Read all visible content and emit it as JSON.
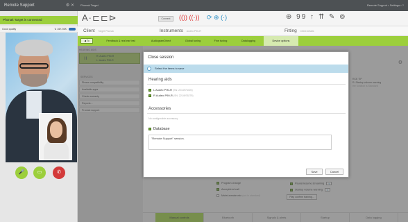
{
  "remote_support": {
    "title": "Remote Support",
    "window_controls": "⚙ ✕",
    "status": "Phonak Target is connected",
    "quality_label": "Good quality",
    "network_label": "⇅ 16K  56K",
    "buttons": {
      "mic": "🎤",
      "camera": "▭",
      "hangup": "✆"
    }
  },
  "topbar": {
    "title": "Phonak Target",
    "right": "Remote Support  •  Settings  •  ?"
  },
  "toolbar": {
    "connect_label": "Connect",
    "icons_left": "A·⊏⊏⊳",
    "icons_red": "(()) ((·))",
    "icons_mid": "⟳ ⊕ (·)",
    "icons_right": "⊕ 99 ↑ ⇈ ✎ ⊚"
  },
  "client_row": {
    "client_label": "Client",
    "client_value": "Target Phonak",
    "instruments_label": "Instruments",
    "instruments_value": "Audéo P90-R",
    "fitting_label": "Fitting",
    "fitting_value": "Client details",
    "back_label": "◀ To"
  },
  "nav_tabs": [
    "Feedback & real ear test",
    "AudiogramDirect",
    "Global tuning",
    "Fine tuning",
    "Datalogging",
    "Device options"
  ],
  "sidebar": {
    "hearing_aids_label": "HEARING AIDS",
    "aid_left": "R: Audéo P90-R",
    "aid_right": "L: Audéo P90-R",
    "aid_icon": "ıı",
    "services_label": "SERVICES",
    "items": [
      "Phone compatibility",
      "Available apps",
      "Check warranty",
      "Reports...",
      "Product support"
    ]
  },
  "right_panel": {
    "text_title": "RCE TIP",
    "text_line1": "R: Startup volume warning",
    "text_line2": "the function is Standard",
    "options_left": [
      "Program change",
      "Accept/end call",
      "Mute/unmute mic"
    ],
    "options_left_note": "(not in standard)",
    "options_right": [
      "Pause/resume streaming",
      "Startup volume warning"
    ],
    "confirm_button": "Play confirm training...",
    "bottom_tabs": [
      "Manual controls",
      "Bluetooth",
      "Signals & alerts",
      "Startup",
      "Data logging"
    ]
  },
  "dialog": {
    "title": "Close session",
    "select_label": "Select the items to save",
    "hearing_aids_heading": "Hearing aids",
    "hearing_aids": [
      {
        "label": "L Audéo P90-R",
        "serial": "(SN: 2214976400)"
      },
      {
        "label": "R Audéo P90-R",
        "serial": "(SN: 2214976279)"
      }
    ],
    "accessories_heading": "Accessories",
    "accessories_note": "No configurable accessory",
    "database_label": "Database",
    "notes_text": "\"Remote Support\" session.",
    "save_button": "Save",
    "cancel_button": "Cancel"
  },
  "colors": {
    "accent_green": "#9ccf3c",
    "dark_bar": "#4d5154",
    "info_band": "#bcdcec",
    "hangup_red": "#d33a3a"
  }
}
